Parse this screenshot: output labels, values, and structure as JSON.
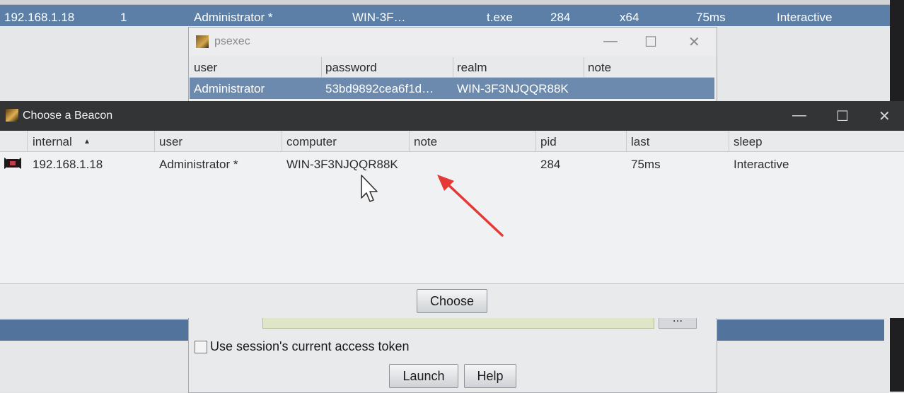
{
  "background_table": {
    "row": {
      "internal": "192.168.1.18",
      "listener": "1",
      "user": "Administrator *",
      "computer": "WIN-3F…",
      "process": "t.exe",
      "pid": "284",
      "arch": "x64",
      "last": "75ms",
      "sleep": "Interactive"
    }
  },
  "psexec_dialog": {
    "title": "psexec",
    "controls": {
      "minimize": "—",
      "maximize": "☐",
      "close": "✕"
    },
    "columns": [
      "user",
      "password",
      "realm",
      "note"
    ],
    "row": {
      "user": "Administrator",
      "password": "53bd9892cea6f1d…",
      "realm": "WIN-3F3NJQQR88K",
      "note": ""
    },
    "session_ellipsis": "...",
    "use_token_label": "Use session's current access token",
    "launch_label": "Launch",
    "help_label": "Help"
  },
  "beacon_dialog": {
    "title": "Choose a Beacon",
    "controls": {
      "minimize": "—",
      "maximize": "☐",
      "close": "✕"
    },
    "columns": {
      "internal": "internal",
      "sort_indicator": "▲",
      "user": "user",
      "computer": "computer",
      "note": "note",
      "pid": "pid",
      "last": "last",
      "sleep": "sleep"
    },
    "row": {
      "internal": "192.168.1.18",
      "user": "Administrator *",
      "computer": "WIN-3F3NJQQR88K",
      "note": "",
      "pid": "284",
      "last": "75ms",
      "sleep": "Interactive"
    },
    "choose_label": "Choose"
  },
  "colors": {
    "selection": "#5b7fa6",
    "title_bar_dark": "#333436",
    "annotation_arrow": "#e53935"
  },
  "icons": [
    "beacon-app-icon",
    "psexec-app-icon",
    "beacon-session-icon",
    "mouse-cursor-icon",
    "red-arrow-icon"
  ]
}
